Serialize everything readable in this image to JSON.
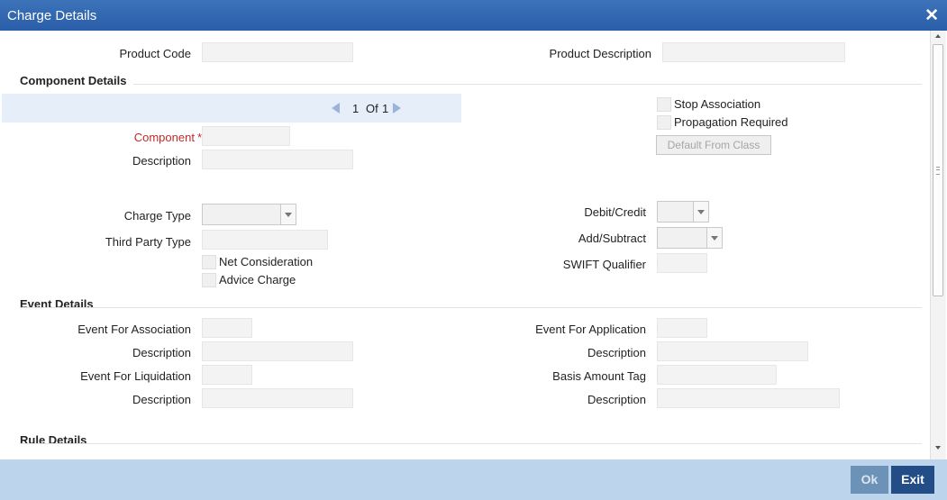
{
  "window": {
    "title": "Charge Details"
  },
  "product": {
    "code_label": "Product Code",
    "code_value": "",
    "desc_label": "Product Description",
    "desc_value": ""
  },
  "component_details": {
    "heading": "Component Details",
    "pager": {
      "current": "1",
      "of": "Of",
      "total": "1"
    },
    "component_label": "Component",
    "component_required": "*",
    "component_value": "",
    "description_label": "Description",
    "description_value": "",
    "stop_association": "Stop Association",
    "propagation_required": "Propagation Required",
    "default_from_class": "Default From Class",
    "charge_type_label": "Charge Type",
    "charge_type_value": "",
    "third_party_type_label": "Third Party Type",
    "third_party_type_value": "",
    "net_consideration": "Net Consideration",
    "advice_charge": "Advice Charge",
    "debit_credit_label": "Debit/Credit",
    "debit_credit_value": "",
    "add_subtract_label": "Add/Subtract",
    "add_subtract_value": "",
    "swift_qualifier_label": "SWIFT Qualifier",
    "swift_qualifier_value": ""
  },
  "event_details": {
    "heading": "Event Details",
    "event_for_association_label": "Event For Association",
    "association_description_label": "Description",
    "event_for_liquidation_label": "Event For Liquidation",
    "liquidation_description_label": "Description",
    "event_for_application_label": "Event For Application",
    "application_description_label": "Description",
    "basis_amount_tag_label": "Basis Amount Tag",
    "basis_description_label": "Description"
  },
  "rule_details": {
    "heading": "Rule Details"
  },
  "footer": {
    "ok_label": "Ok",
    "exit_label": "Exit"
  },
  "icons": {
    "close": "close-icon",
    "prev": "prev-arrow-icon",
    "next": "next-arrow-icon"
  },
  "colors": {
    "titlebar": "#2f65ad",
    "footer": "#bcd4ec",
    "exit_button": "#224d86",
    "required": "#c62828"
  }
}
